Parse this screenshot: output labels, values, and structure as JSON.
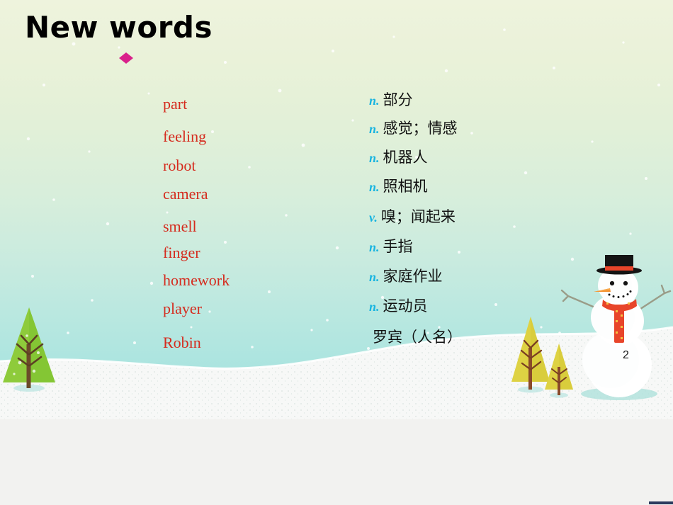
{
  "slide": {
    "title": "New words",
    "page_number": "2",
    "bullet_icon": "diamond-bullet-icon",
    "theme": {
      "background_top": "#eef3dd",
      "background_bottom": "#9fe1de",
      "word_color": "#d52b1e",
      "pos_color": "#18b4e0",
      "definition_color": "#111111",
      "bullet_color": "#d9218b",
      "snow_color": "#ffffff"
    },
    "entries": [
      {
        "word": "part",
        "pos": "n.",
        "meaning": "部分"
      },
      {
        "word": "feeling",
        "pos": "n.",
        "meaning": "感觉；情感"
      },
      {
        "word": "robot",
        "pos": "n.",
        "meaning": "机器人"
      },
      {
        "word": "camera",
        "pos": "n.",
        "meaning": "照相机"
      },
      {
        "word": "smell",
        "pos": "v.",
        "meaning": "嗅；闻起来"
      },
      {
        "word": "finger",
        "pos": "n.",
        "meaning": "手指"
      },
      {
        "word": "homework",
        "pos": "n.",
        "meaning": "家庭作业"
      },
      {
        "word": "player",
        "pos": "n.",
        "meaning": "运动员"
      },
      {
        "word": "Robin",
        "pos": "",
        "meaning": "罗宾（人名）"
      }
    ],
    "decor": {
      "snowman": "snowman-illustration",
      "green_tree": "green-fir-tree-icon",
      "yellow_tree_large": "yellow-fir-tree-icon",
      "yellow_tree_small": "yellow-fir-tree-small-icon",
      "snow_ground": "snow-ground"
    }
  }
}
